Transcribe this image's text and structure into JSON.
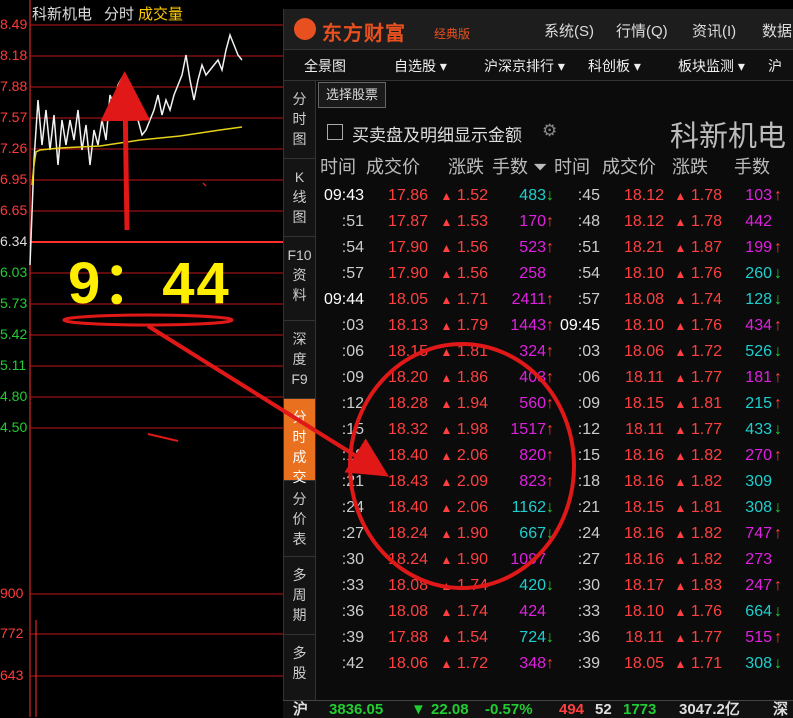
{
  "chart": {
    "stock_name": "科新机电",
    "tab_time": "分时",
    "tab_volume": "成交量",
    "y_labels": [
      {
        "text": "8.49",
        "c": "r"
      },
      {
        "text": "8.18",
        "c": "r"
      },
      {
        "text": "7.88",
        "c": "r"
      },
      {
        "text": "7.57",
        "c": "r"
      },
      {
        "text": "7.26",
        "c": "r"
      },
      {
        "text": "6.95",
        "c": "r"
      },
      {
        "text": "6.65",
        "c": "r"
      },
      {
        "text": "6.34",
        "c": "w"
      },
      {
        "text": "6.03",
        "c": "g"
      },
      {
        "text": "5.73",
        "c": "g"
      },
      {
        "text": "5.42",
        "c": "g"
      },
      {
        "text": "5.11",
        "c": "g"
      },
      {
        "text": "4.80",
        "c": "g"
      },
      {
        "text": "4.50",
        "c": "g"
      }
    ],
    "vol_labels": [
      "900",
      "772",
      "643"
    ],
    "annotation_time": "9：44"
  },
  "app": {
    "logo": "东方财富",
    "edition": "经典版",
    "menu": [
      "系统(S)",
      "行情(Q)",
      "资讯(I)",
      "数据"
    ],
    "nav": [
      {
        "label": "全景图",
        "dd": false
      },
      {
        "label": "自选股",
        "dd": true
      },
      {
        "label": "沪深京排行",
        "dd": true
      },
      {
        "label": "科创板",
        "dd": true
      },
      {
        "label": "板块监测",
        "dd": true
      },
      {
        "label": "沪",
        "dd": false
      }
    ],
    "side_tabs": [
      "分时图",
      "K线图",
      "F10资料",
      "深度F9",
      "分时成交",
      "分价表",
      "多周期",
      "多股"
    ],
    "active_tab": 4,
    "select_stock_button": "选择股票",
    "checkbox_label": "买卖盘及明细显示金额",
    "stock_title": "科新机电"
  },
  "table": {
    "headers": [
      "时间",
      "成交价",
      "涨跌",
      "手数",
      "时间",
      "成交价",
      "涨跌",
      "手数"
    ],
    "left_rows": [
      {
        "t": "09:43",
        "p": "17.86",
        "c": "1.52",
        "v": "483",
        "vc": "g",
        "a": "dn"
      },
      {
        "t": ":51",
        "p": "17.87",
        "c": "1.53",
        "v": "170",
        "vc": "m",
        "a": "up"
      },
      {
        "t": ":54",
        "p": "17.90",
        "c": "1.56",
        "v": "523",
        "vc": "m",
        "a": "up"
      },
      {
        "t": ":57",
        "p": "17.90",
        "c": "1.56",
        "v": "258",
        "vc": "m",
        "a": ""
      },
      {
        "t": "09:44",
        "p": "18.05",
        "c": "1.71",
        "v": "2411",
        "vc": "m",
        "a": "up"
      },
      {
        "t": ":03",
        "p": "18.13",
        "c": "1.79",
        "v": "1443",
        "vc": "m",
        "a": "up"
      },
      {
        "t": ":06",
        "p": "18.15",
        "c": "1.81",
        "v": "324",
        "vc": "m",
        "a": "up"
      },
      {
        "t": ":09",
        "p": "18.20",
        "c": "1.86",
        "v": "403",
        "vc": "m",
        "a": "up"
      },
      {
        "t": ":12",
        "p": "18.28",
        "c": "1.94",
        "v": "560",
        "vc": "m",
        "a": "up"
      },
      {
        "t": ":15",
        "p": "18.32",
        "c": "1.98",
        "v": "1517",
        "vc": "m",
        "a": "up"
      },
      {
        "t": ":18",
        "p": "18.40",
        "c": "2.06",
        "v": "820",
        "vc": "m",
        "a": "up"
      },
      {
        "t": ":21",
        "p": "18.43",
        "c": "2.09",
        "v": "823",
        "vc": "m",
        "a": "up"
      },
      {
        "t": ":24",
        "p": "18.40",
        "c": "2.06",
        "v": "1162",
        "vc": "g",
        "a": "dn"
      },
      {
        "t": ":27",
        "p": "18.24",
        "c": "1.90",
        "v": "667",
        "vc": "g",
        "a": "dn"
      },
      {
        "t": ":30",
        "p": "18.24",
        "c": "1.90",
        "v": "1097",
        "vc": "m",
        "a": ""
      },
      {
        "t": ":33",
        "p": "18.08",
        "c": "1.74",
        "v": "420",
        "vc": "g",
        "a": "dn"
      },
      {
        "t": ":36",
        "p": "18.08",
        "c": "1.74",
        "v": "424",
        "vc": "m",
        "a": ""
      },
      {
        "t": ":39",
        "p": "17.88",
        "c": "1.54",
        "v": "724",
        "vc": "g",
        "a": "dn"
      },
      {
        "t": ":42",
        "p": "18.06",
        "c": "1.72",
        "v": "348",
        "vc": "m",
        "a": "up"
      }
    ],
    "right_rows": [
      {
        "t": ":45",
        "p": "18.12",
        "c": "1.78",
        "v": "103",
        "vc": "m",
        "a": "up"
      },
      {
        "t": ":48",
        "p": "18.12",
        "c": "1.78",
        "v": "442",
        "vc": "m",
        "a": ""
      },
      {
        "t": ":51",
        "p": "18.21",
        "c": "1.87",
        "v": "199",
        "vc": "m",
        "a": "up"
      },
      {
        "t": ":54",
        "p": "18.10",
        "c": "1.76",
        "v": "260",
        "vc": "g",
        "a": "dn"
      },
      {
        "t": ":57",
        "p": "18.08",
        "c": "1.74",
        "v": "128",
        "vc": "g",
        "a": "dn"
      },
      {
        "t": "09:45",
        "p": "18.10",
        "c": "1.76",
        "v": "434",
        "vc": "m",
        "a": "up"
      },
      {
        "t": ":03",
        "p": "18.06",
        "c": "1.72",
        "v": "526",
        "vc": "g",
        "a": "dn"
      },
      {
        "t": ":06",
        "p": "18.11",
        "c": "1.77",
        "v": "181",
        "vc": "m",
        "a": "up"
      },
      {
        "t": ":09",
        "p": "18.15",
        "c": "1.81",
        "v": "215",
        "vc": "g",
        "a": "up"
      },
      {
        "t": ":12",
        "p": "18.11",
        "c": "1.77",
        "v": "433",
        "vc": "g",
        "a": "dn"
      },
      {
        "t": ":15",
        "p": "18.16",
        "c": "1.82",
        "v": "270",
        "vc": "m",
        "a": "up"
      },
      {
        "t": ":18",
        "p": "18.16",
        "c": "1.82",
        "v": "309",
        "vc": "g",
        "a": ""
      },
      {
        "t": ":21",
        "p": "18.15",
        "c": "1.81",
        "v": "308",
        "vc": "g",
        "a": "dn"
      },
      {
        "t": ":24",
        "p": "18.16",
        "c": "1.82",
        "v": "747",
        "vc": "m",
        "a": "up"
      },
      {
        "t": ":27",
        "p": "18.16",
        "c": "1.82",
        "v": "273",
        "vc": "m",
        "a": ""
      },
      {
        "t": ":30",
        "p": "18.17",
        "c": "1.83",
        "v": "247",
        "vc": "m",
        "a": "up"
      },
      {
        "t": ":33",
        "p": "18.10",
        "c": "1.76",
        "v": "664",
        "vc": "g",
        "a": "dn"
      },
      {
        "t": ":36",
        "p": "18.11",
        "c": "1.77",
        "v": "515",
        "vc": "m",
        "a": "up"
      },
      {
        "t": ":39",
        "p": "18.05",
        "c": "1.71",
        "v": "308",
        "vc": "g",
        "a": "dn"
      }
    ]
  },
  "statusbar": {
    "label": "沪",
    "index": "3836.05",
    "chg": "22.08",
    "pct": "-0.57%",
    "val1": "494",
    "val2": "52",
    "val3": "1773",
    "val4": "3047.2亿",
    "end": "深"
  },
  "colors": {
    "up": "#ff4040",
    "down": "#22cc33",
    "accent": "#e8701f",
    "magenta": "#e020e0",
    "cyan": "#1ecfcf",
    "yellow": "#ffee00",
    "annotation": "#e01818"
  }
}
